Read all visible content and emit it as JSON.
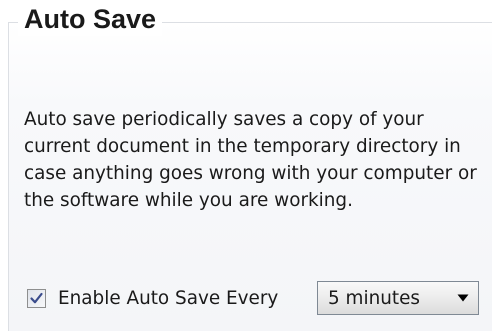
{
  "group": {
    "title": "Auto Save"
  },
  "description": "Auto save periodically saves a copy of your current document in the temporary directory in case anything goes wrong with your computer or the software while you are working.",
  "auto_save": {
    "checkbox_label": "Enable Auto Save Every",
    "checked": true,
    "interval": {
      "selected": "5 minutes"
    }
  },
  "icons": {
    "checkbox": "checkmark-icon",
    "dropdown": "triangle-down-icon"
  },
  "colors": {
    "check_mark": "#3a4c8c",
    "border": "#dcdfe4"
  }
}
